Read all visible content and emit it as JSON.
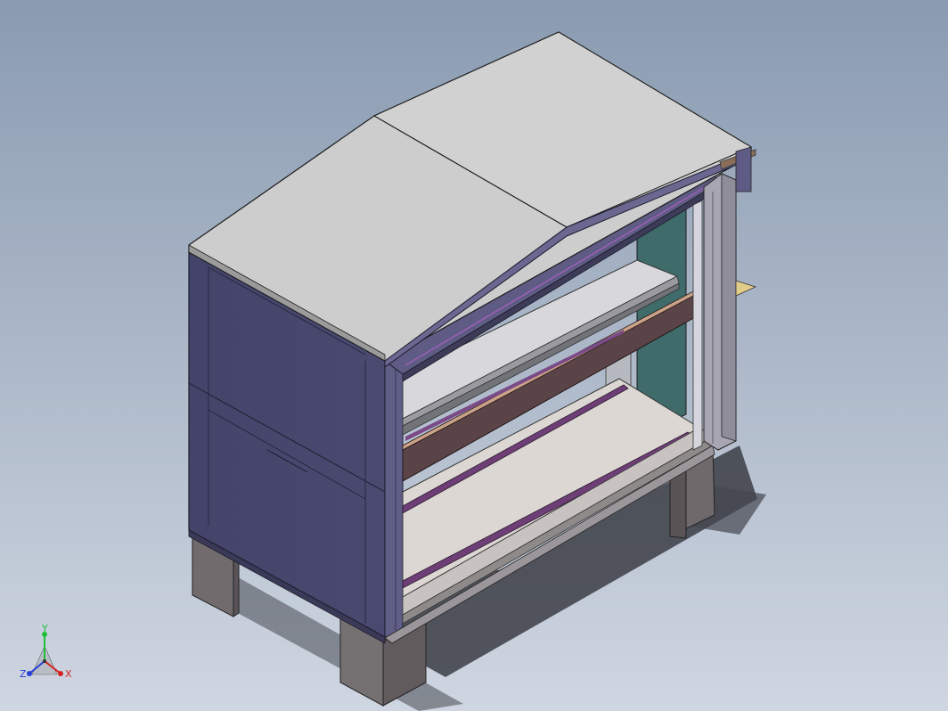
{
  "viewport": {
    "background_top": "#8a9bb1",
    "background_bottom": "#cfd6e1"
  },
  "model": {
    "roof_color": "#cdcdcd",
    "side_panel_color": "#47476a",
    "frame_color": "#5c5a80",
    "interior_wall_color": "#3f6b6b",
    "floor_color": "#dcd7d2",
    "support_color": "#6a6468",
    "rail_color": "#6e3f76",
    "beam_color": "#5b4448",
    "shelf_color": "#d8d8dc",
    "tab_color": "#e2cc8a"
  },
  "triad": {
    "y_label": "Y",
    "x_label": "X",
    "z_label": "Z",
    "y_color": "#1fbf3a",
    "x_color": "#d42222",
    "z_color": "#2a3fd8"
  }
}
